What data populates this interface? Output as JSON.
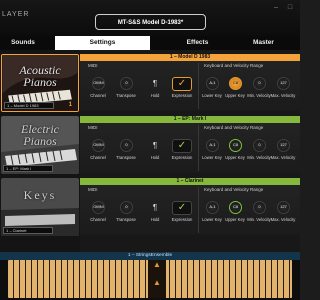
{
  "app": {
    "brand": "LAYER",
    "preset_name": "MT-S&S Model D-1983*",
    "window_buttons": [
      "–",
      "□"
    ]
  },
  "tabs": [
    {
      "label": "Sounds",
      "active": false
    },
    {
      "label": "Settings",
      "active": true
    },
    {
      "label": "Effects",
      "active": false
    },
    {
      "label": "Master",
      "active": false
    }
  ],
  "sidebar": {
    "cards": [
      {
        "title_lines": [
          "Acoustic",
          "Pianos"
        ],
        "preset": "1 – Model D 1983",
        "number": "1",
        "selected": true
      },
      {
        "title_lines": [
          "Electric",
          "Pianos"
        ],
        "preset": "1 – EP: Mark I",
        "number": "",
        "selected": false
      },
      {
        "title_lines": [
          "Keys"
        ],
        "preset": "1 – Clarinet",
        "number": "",
        "selected": false
      }
    ],
    "bottom_buttons": [
      "+",
      "✎"
    ]
  },
  "layers": [
    {
      "header": "1 – Model D 1983",
      "accent": "#f4a23a",
      "midi_label": "MIDI",
      "range_label": "Keyboard and Velocity Range",
      "channel": "OMNI",
      "transpose": "0",
      "hold_label": "Hold",
      "expression_label": "Expression",
      "lower_key": "A-1",
      "upper_key": "C8",
      "min_velocity": "0",
      "max_velocity": "127"
    },
    {
      "header": "1 – EP: Mark I",
      "accent": "#86b83e",
      "midi_label": "MIDI",
      "range_label": "Keyboard and Velocity Range",
      "channel": "OMNI",
      "transpose": "0",
      "hold_label": "Hold",
      "expression_label": "Expression",
      "lower_key": "A-1",
      "upper_key": "C8",
      "min_velocity": "0",
      "max_velocity": "127"
    },
    {
      "header": "1 – Clarinet",
      "accent": "#86b83e",
      "midi_label": "MIDI",
      "range_label": "Keyboard and Velocity Range",
      "channel": "OMNI",
      "transpose": "0",
      "hold_label": "Hold",
      "expression_label": "Expression",
      "lower_key": "A-1",
      "upper_key": "C8",
      "min_velocity": "0",
      "max_velocity": "127"
    }
  ],
  "control_labels": {
    "channel": "Channel",
    "transpose": "Transpose",
    "lower_key": "Lower Key",
    "upper_key": "Upper Key",
    "min_velocity": "Min. Velocity",
    "max_velocity": "Max. Velocity"
  },
  "bottom_layer": {
    "header": "1 – StringsEnsemble"
  },
  "keyboard": {
    "range_arrow": "▲"
  }
}
